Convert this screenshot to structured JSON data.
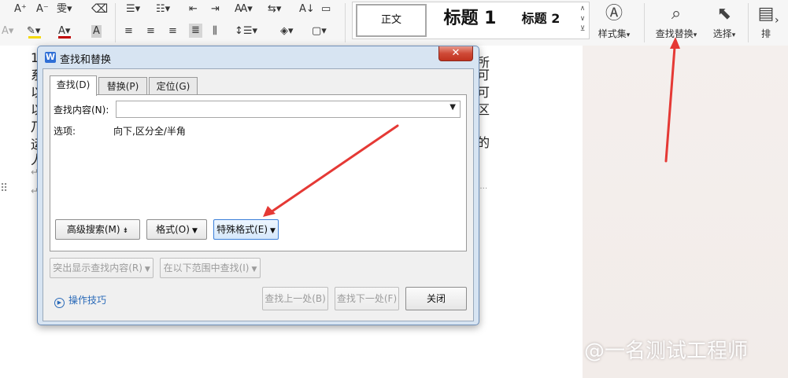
{
  "ribbon": {
    "row1_icons": [
      "font-grow-icon",
      "font-shrink-icon",
      "phonetic-icon",
      "clear-format-icon",
      "bullets-icon",
      "numbering-icon",
      "outdent-icon",
      "indent-icon",
      "text-direction-icon",
      "sort-icon",
      "char-border-icon"
    ],
    "row2_icons": [
      "text-effect-icon",
      "highlight-icon",
      "font-color-icon",
      "char-shading-icon",
      "align-left-icon",
      "align-center-icon",
      "align-right-icon",
      "justify-icon",
      "distributed-icon",
      "line-spacing-icon",
      "shading-icon",
      "border-icon"
    ],
    "styles": {
      "normal": "正文",
      "heading1": "标题 1",
      "heading2": "标题 2"
    },
    "style_set_label": "样式集",
    "find_replace_label": "查找替换",
    "select_label": "选择",
    "arrange_label": "排",
    "highlight_color": "#f5d90a",
    "font_color": "#c00000"
  },
  "document": {
    "left_chars": [
      "1",
      "系",
      "以",
      "以",
      "乃",
      "运",
      "人",
      "↵",
      "↵"
    ],
    "right_chars": [
      "所",
      "可",
      "可",
      "区",
      "",
      "的",
      ""
    ]
  },
  "dialog": {
    "title": "查找和替换",
    "logo": "W",
    "close_label": "✕",
    "tabs": [
      {
        "label": "查找(D)",
        "active": true
      },
      {
        "label": "替换(P)",
        "active": false
      },
      {
        "label": "定位(G)",
        "active": false
      }
    ],
    "find_label": "查找内容(N):",
    "find_value": "",
    "options_label": "选项:",
    "options_value": "向下,区分全/半角",
    "buttons": {
      "advanced_search": "高级搜索(M)",
      "format": "格式(O)",
      "special_format": "特殊格式(E)",
      "highlight_results": "突出显示查找内容(R)",
      "find_in_range": "在以下范围中查找(I)",
      "find_prev": "查找上一处(B)",
      "find_next": "查找下一处(F)",
      "close": "关闭"
    },
    "tips_label": "操作技巧"
  },
  "watermark": "@一名测试工程师",
  "annotation_color": "#e53935"
}
